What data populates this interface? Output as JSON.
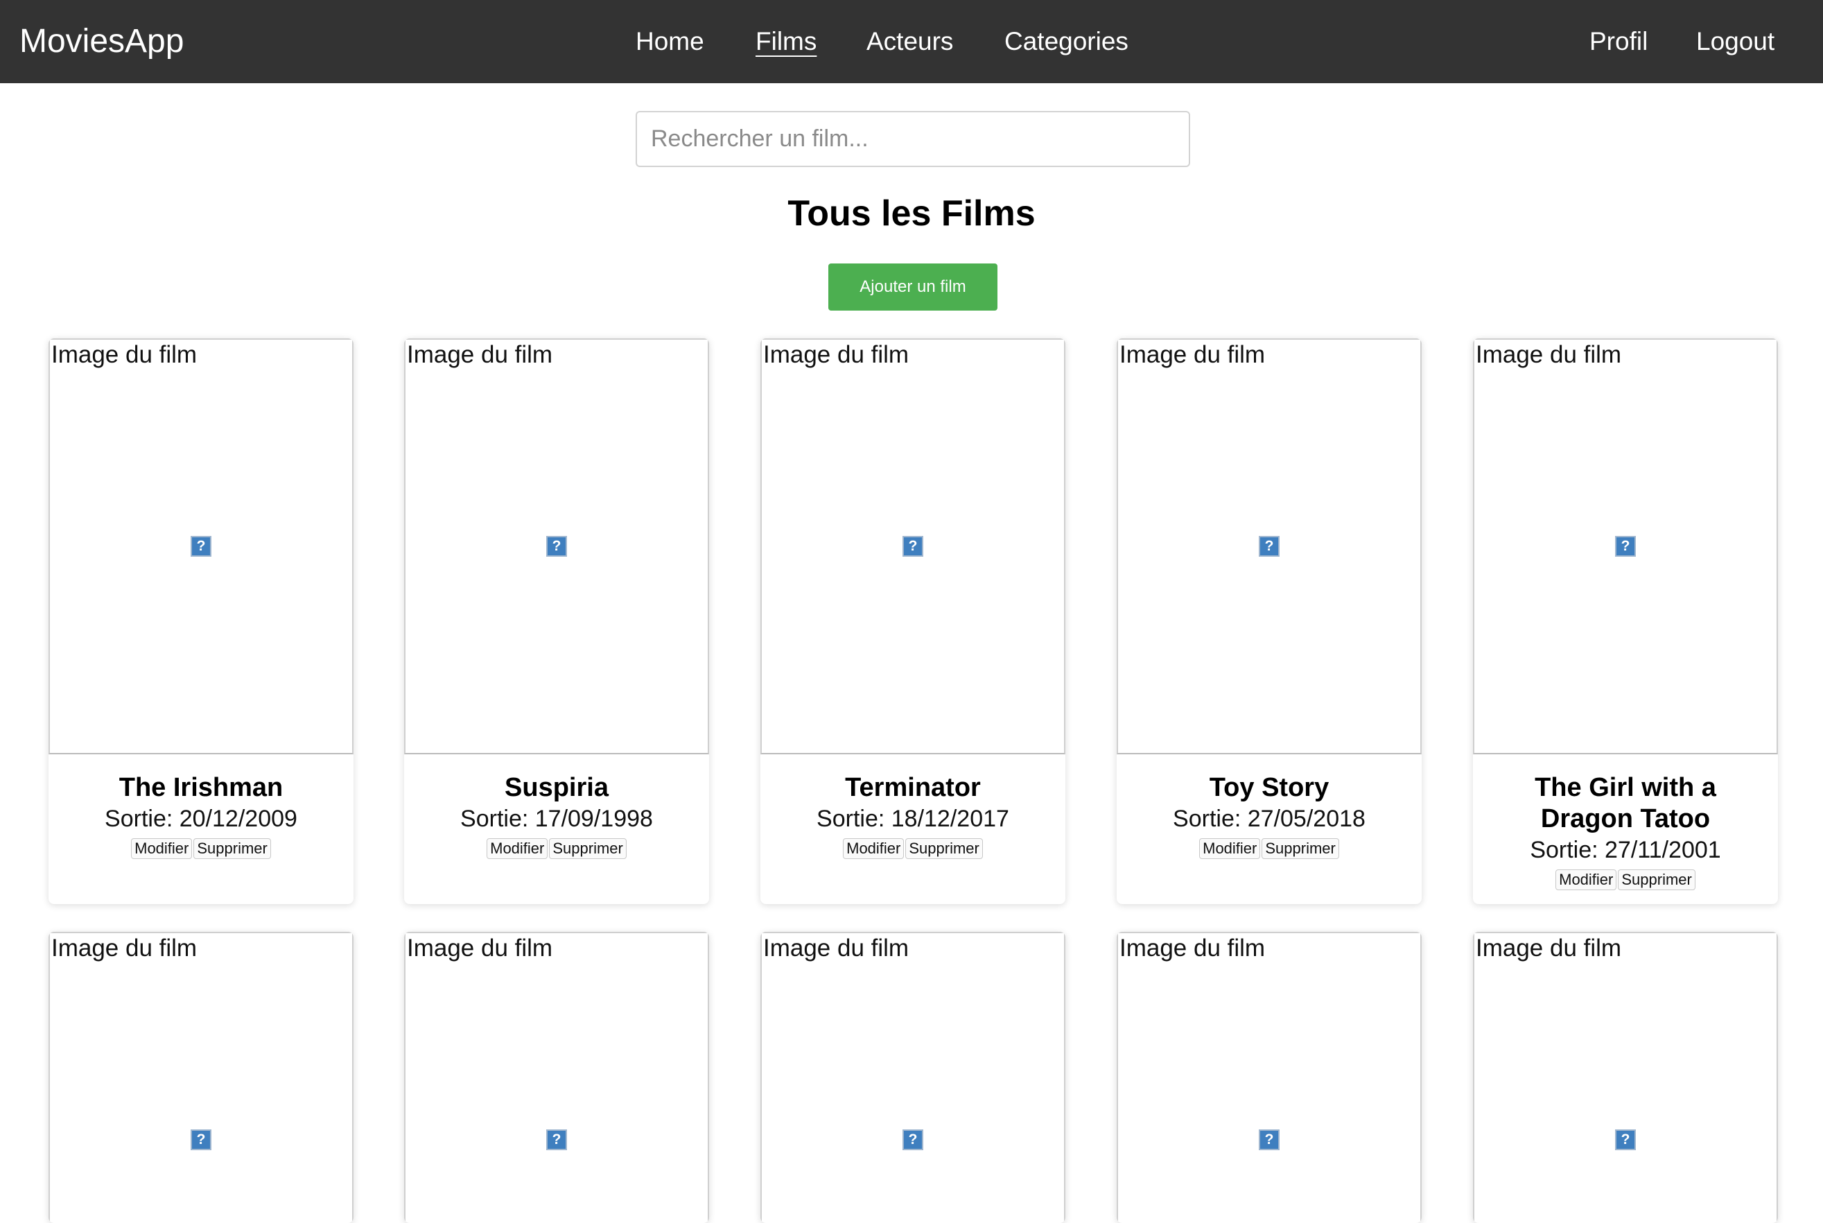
{
  "header": {
    "brand": "MoviesApp",
    "nav": [
      {
        "label": "Home"
      },
      {
        "label": "Films",
        "active": true
      },
      {
        "label": "Acteurs"
      },
      {
        "label": "Categories"
      }
    ],
    "right": [
      {
        "label": "Profil"
      },
      {
        "label": "Logout"
      }
    ]
  },
  "search": {
    "placeholder": "Rechercher un film..."
  },
  "main": {
    "title": "Tous les Films",
    "add_button": "Ajouter un film"
  },
  "card_image_alt": "Image du film",
  "card_actions": {
    "edit": "Modifier",
    "delete": "Supprimer"
  },
  "broken_image_glyph": "?",
  "films": [
    {
      "title": "The Irishman",
      "date": "Sortie: 20/12/2009"
    },
    {
      "title": "Suspiria",
      "date": "Sortie: 17/09/1998"
    },
    {
      "title": "Terminator",
      "date": "Sortie: 18/12/2017"
    },
    {
      "title": "Toy Story",
      "date": "Sortie: 27/05/2018"
    },
    {
      "title": "The Girl with a Dragon Tatoo",
      "date": "Sortie: 27/11/2001"
    }
  ],
  "colors": {
    "navbar_bg": "#333333",
    "add_button_bg": "#4caf50",
    "broken_icon": "#3f7fbf"
  }
}
